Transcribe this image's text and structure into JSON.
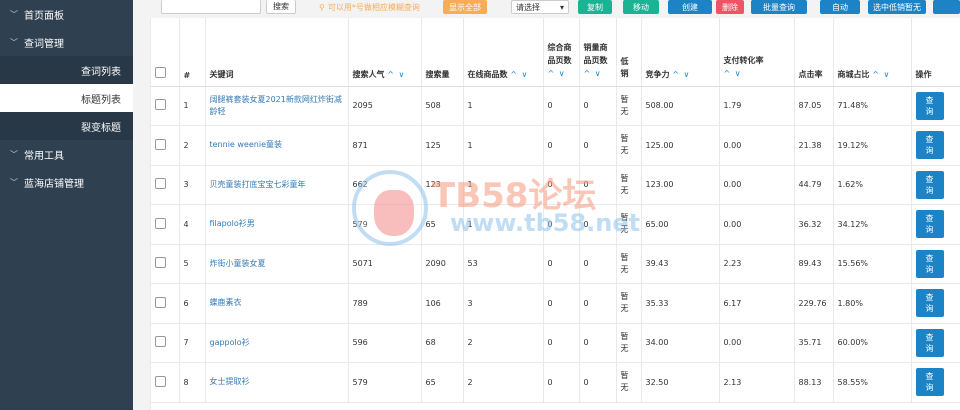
{
  "sidebar": {
    "items": [
      {
        "label": "首页面板",
        "type": "group"
      },
      {
        "label": "查词管理",
        "type": "group"
      },
      {
        "label": "查词列表",
        "type": "sub"
      },
      {
        "label": "标题列表",
        "type": "sub-active"
      },
      {
        "label": "裂变标题",
        "type": "sub"
      },
      {
        "label": "常用工具",
        "type": "group"
      },
      {
        "label": "蓝海店铺管理",
        "type": "group"
      }
    ]
  },
  "toolbar": {
    "search_label": "搜索",
    "hint": "可以用*号做相应模糊查询",
    "show_all": "显示全部",
    "select_value": "请选择",
    "copy": "复制",
    "move": "移动",
    "create": "创建",
    "delete": "删除",
    "batch_query": "批量查询",
    "auto": "自动",
    "pick_low": "选中低销暂无"
  },
  "table": {
    "headers": {
      "index": "#",
      "keyword": "关键词",
      "popularity": "搜索人气",
      "search_volume": "搜索量",
      "online_count": "在线商品数",
      "comp_pages": "综合商品页数",
      "sales_pages": "销量商品页数",
      "low_sales": "低销",
      "competition": "竞争力",
      "pay_rate": "支付转化率",
      "ctr": "点击率",
      "mall_ratio": "商城占比",
      "action": "操作"
    },
    "rows": [
      {
        "idx": "1",
        "keyword": "阔腿裤套装女夏2021新款网红炸街减龄轻",
        "pop": "2095",
        "vol": "508",
        "online": "1",
        "comp": "0",
        "sales": "0",
        "low": "暂无",
        "compet": "508.00",
        "pay": "1.79",
        "ctr": "87.05",
        "mall": "71.48%",
        "btn": "查询"
      },
      {
        "idx": "2",
        "keyword": "tennie weenie童装",
        "pop": "871",
        "vol": "125",
        "online": "1",
        "comp": "0",
        "sales": "0",
        "low": "暂无",
        "compet": "125.00",
        "pay": "0.00",
        "ctr": "21.38",
        "mall": "19.12%",
        "btn": "查询"
      },
      {
        "idx": "3",
        "keyword": "贝壳童装打底宝宝七彩童年",
        "pop": "662",
        "vol": "123",
        "online": "1",
        "comp": "0",
        "sales": "0",
        "low": "暂无",
        "compet": "123.00",
        "pay": "0.00",
        "ctr": "44.79",
        "mall": "1.62%",
        "btn": "查询"
      },
      {
        "idx": "4",
        "keyword": "filapolo衫男",
        "pop": "579",
        "vol": "65",
        "online": "1",
        "comp": "0",
        "sales": "0",
        "low": "暂无",
        "compet": "65.00",
        "pay": "0.00",
        "ctr": "36.32",
        "mall": "34.12%",
        "btn": "查询"
      },
      {
        "idx": "5",
        "keyword": "炸街小童装女夏",
        "pop": "5071",
        "vol": "2090",
        "online": "53",
        "comp": "0",
        "sales": "0",
        "low": "暂无",
        "compet": "39.43",
        "pay": "2.23",
        "ctr": "89.43",
        "mall": "15.56%",
        "btn": "查询"
      },
      {
        "idx": "6",
        "keyword": "蝶鹿素衣",
        "pop": "789",
        "vol": "106",
        "online": "3",
        "comp": "0",
        "sales": "0",
        "low": "暂无",
        "compet": "35.33",
        "pay": "6.17",
        "ctr": "229.76",
        "mall": "1.80%",
        "btn": "查询"
      },
      {
        "idx": "7",
        "keyword": "gappolo衫",
        "pop": "596",
        "vol": "68",
        "online": "2",
        "comp": "0",
        "sales": "0",
        "low": "暂无",
        "compet": "34.00",
        "pay": "0.00",
        "ctr": "35.71",
        "mall": "60.00%",
        "btn": "查询"
      },
      {
        "idx": "8",
        "keyword": "女士提取衫",
        "pop": "579",
        "vol": "65",
        "online": "2",
        "comp": "0",
        "sales": "0",
        "low": "暂无",
        "compet": "32.50",
        "pay": "2.13",
        "ctr": "88.13",
        "mall": "58.55%",
        "btn": "查询"
      }
    ]
  },
  "watermark": {
    "title": "TB58论坛",
    "url": "www.tb58.net"
  },
  "colors": {
    "sidebar_bg": "#2f4050",
    "primary": "#1c84c6",
    "success": "#1ab394",
    "warning": "#f8ac59",
    "danger": "#ed5565"
  },
  "icons": {
    "hint": "location-pin-icon",
    "sidebar_chevron": "chevron-down-icon",
    "select": "caret-down-icon",
    "sort": "sort-arrows-icon"
  }
}
